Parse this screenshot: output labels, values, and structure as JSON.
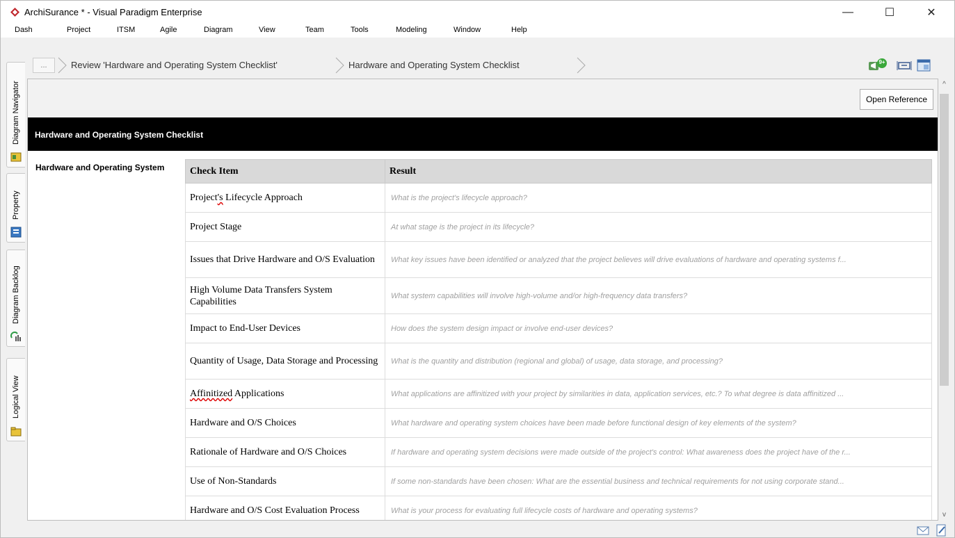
{
  "window": {
    "title": "ArchiSurance * - Visual Paradigm Enterprise",
    "minimize": "—",
    "maximize": "☐",
    "close": "✕"
  },
  "menu": [
    "Dash",
    "Project",
    "ITSM",
    "Agile",
    "Diagram",
    "View",
    "Team",
    "Tools",
    "Modeling",
    "Window",
    "Help"
  ],
  "side_tabs": [
    "Diagram Navigator",
    "Property",
    "Diagram Backlog",
    "Logical View"
  ],
  "breadcrumb": {
    "dots": "...",
    "items": [
      "Review 'Hardware and Operating System Checklist'",
      "Hardware and Operating System Checklist"
    ]
  },
  "toolbar": {
    "notification_badge": "9+"
  },
  "content": {
    "open_reference": "Open Reference",
    "banner_title": "Hardware and Operating System Checklist",
    "section_label": "Hardware and Operating System",
    "columns": [
      "Check Item",
      "Result"
    ],
    "rows": [
      {
        "item": "Project's Lifecycle Approach",
        "result": "What is the project's lifecycle approach?"
      },
      {
        "item": "Project Stage",
        "result": "At what stage is the project in its lifecycle?"
      },
      {
        "item": "Issues that Drive Hardware and O/S Evaluation",
        "result": "What key issues have been identified or analyzed that the project believes will drive evaluations of hardware and operating systems f..."
      },
      {
        "item": "High Volume Data Transfers System Capabilities",
        "result": "What system capabilities will involve high-volume and/or high-frequency data transfers?"
      },
      {
        "item": "Impact to End-User Devices",
        "result": "How does the system design impact or involve end-user devices?"
      },
      {
        "item": "Quantity of Usage, Data Storage and Processing",
        "result": "What is the quantity and distribution (regional and global) of usage, data storage, and processing?"
      },
      {
        "item": "Affinitized Applications",
        "result": "What applications are affinitized with your project by similarities in data, application services, etc.? To what degree is data affinitized ..."
      },
      {
        "item": "Hardware and O/S Choices",
        "result": "What hardware and operating system choices have been made before functional design of key elements of the system?"
      },
      {
        "item": "Rationale of Hardware and O/S Choices",
        "result": "If hardware and operating system decisions were made outside of the project's control: What awareness does the project have of the r..."
      },
      {
        "item": "Use of Non-Standards",
        "result": "If some non-standards have been chosen: What are the essential business and technical requirements for not using corporate stand..."
      },
      {
        "item": "Hardware and O/S Cost Evaluation Process",
        "result": "What is your process for evaluating full lifecycle costs of hardware and operating systems?"
      }
    ]
  },
  "scroll": {
    "up": "^",
    "down": "v"
  }
}
